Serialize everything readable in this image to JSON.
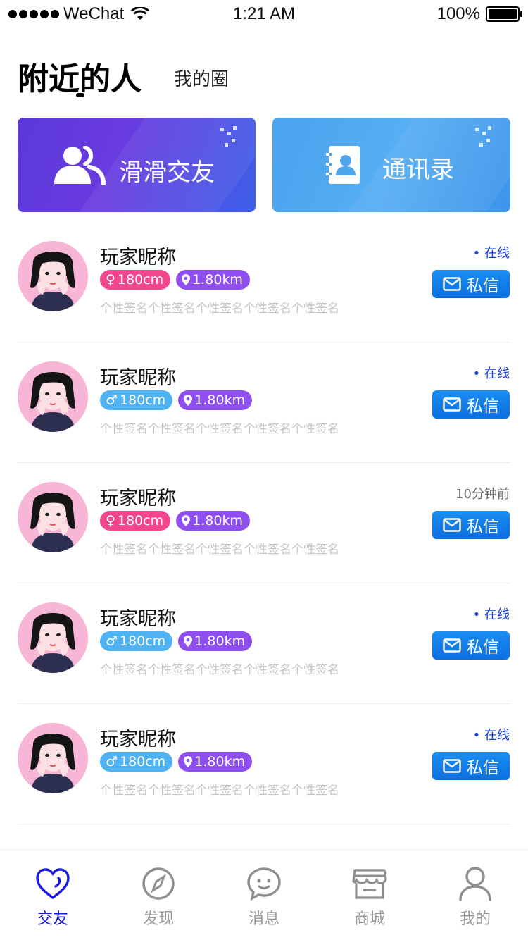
{
  "status_bar": {
    "carrier": "WeChat",
    "time": "1:21 AM",
    "battery": "100%"
  },
  "header": {
    "active_tab": "附近的人",
    "inactive_tab": "我的圈"
  },
  "banners": {
    "swipe": "滑滑交友",
    "contacts": "通讯录"
  },
  "users": [
    {
      "nickname": "玩家昵称",
      "gender": "female",
      "height": "180cm",
      "distance": "1.80km",
      "signature": "个性签名个性签名个性签名个性签名个性签名",
      "status": "• 在线",
      "online": true,
      "dm": "私信"
    },
    {
      "nickname": "玩家昵称",
      "gender": "male",
      "height": "180cm",
      "distance": "1.80km",
      "signature": "个性签名个性签名个性签名个性签名个性签名",
      "status": "• 在线",
      "online": true,
      "dm": "私信"
    },
    {
      "nickname": "玩家昵称",
      "gender": "female",
      "height": "180cm",
      "distance": "1.80km",
      "signature": "个性签名个性签名个性签名个性签名个性签名",
      "status": "10分钟前",
      "online": false,
      "dm": "私信"
    },
    {
      "nickname": "玩家昵称",
      "gender": "male",
      "height": "180cm",
      "distance": "1.80km",
      "signature": "个性签名个性签名个性签名个性签名个性签名",
      "status": "• 在线",
      "online": true,
      "dm": "私信"
    },
    {
      "nickname": "玩家昵称",
      "gender": "male",
      "height": "180cm",
      "distance": "1.80km",
      "signature": "个性签名个性签名个性签名个性签名个性签名",
      "status": "• 在线",
      "online": true,
      "dm": "私信"
    }
  ],
  "bottom_nav": [
    {
      "label": "交友",
      "icon": "heart-icon",
      "active": true
    },
    {
      "label": "发现",
      "icon": "compass-icon",
      "active": false
    },
    {
      "label": "消息",
      "icon": "chat-bubble-icon",
      "active": false
    },
    {
      "label": "商城",
      "icon": "store-icon",
      "active": false
    },
    {
      "label": "我的",
      "icon": "person-icon",
      "active": false
    }
  ],
  "colors": {
    "accent": "#1a1adf",
    "female_tag": "#f2478f",
    "male_tag": "#4fb2f2",
    "distance_tag": "#8f4ff0",
    "dm_button": "#0c6fe0"
  }
}
